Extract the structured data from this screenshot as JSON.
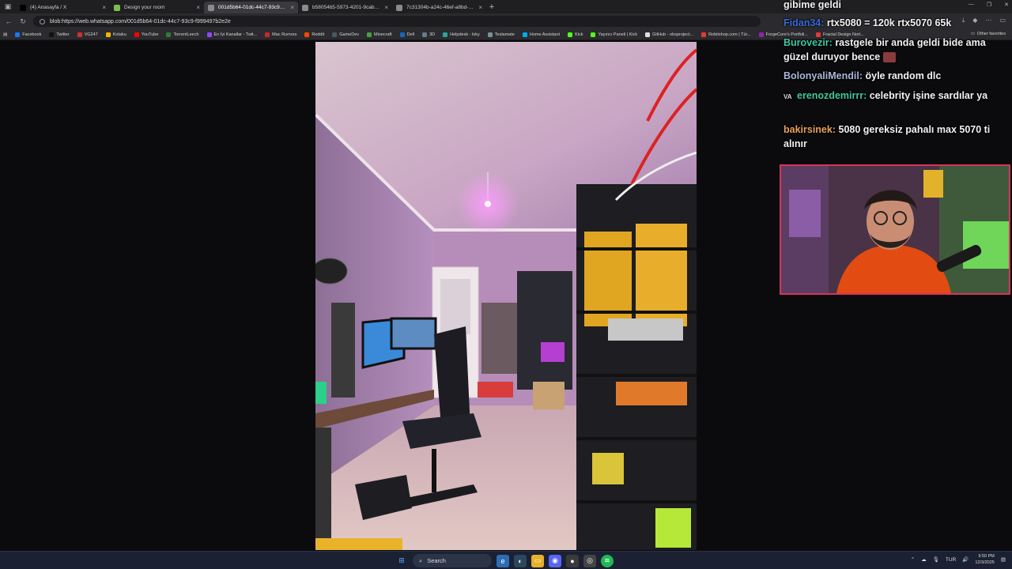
{
  "browser": {
    "tabs": [
      {
        "title": "(4) Anasayfa / X",
        "icon": "x-logo-icon",
        "color": "#000000",
        "active": false
      },
      {
        "title": "Design your room",
        "icon": "design-app-icon",
        "color": "#7bbf4a",
        "active": false
      },
      {
        "title": "001d5b64-01dc-44c7-93c9-f9994...",
        "icon": "globe-icon",
        "color": "#8a8a8a",
        "active": true
      },
      {
        "title": "b58054b5-5973-4201-9cab-0e7...",
        "icon": "globe-icon",
        "color": "#8a8a8a",
        "active": false
      },
      {
        "title": "7c31304b-a24c-46ef-a8bd-134f...",
        "icon": "globe-icon",
        "color": "#8a8a8a",
        "active": false
      }
    ],
    "address": "blob:https://web.whatsapp.com/001d5b64-01dc-44c7-93c9-f999497b2e2e",
    "bookmarks": [
      {
        "label": "Facebook",
        "color": "#1877f2"
      },
      {
        "label": "Twitter",
        "color": "#111111"
      },
      {
        "label": "VG247",
        "color": "#d32f2f"
      },
      {
        "label": "Kotaku",
        "color": "#f4b400"
      },
      {
        "label": "YouTube",
        "color": "#ff0000"
      },
      {
        "label": "TorrentLeech",
        "color": "#2e7d32"
      },
      {
        "label": "En İyi Kanallar - Twit...",
        "color": "#9146ff"
      },
      {
        "label": "Mac Rumors",
        "color": "#c62828"
      },
      {
        "label": "Reddit",
        "color": "#ff4500"
      },
      {
        "label": "GameDev",
        "color": "#455a64"
      },
      {
        "label": "Minecraft",
        "color": "#43a047"
      },
      {
        "label": "Dell",
        "color": "#1565c0"
      },
      {
        "label": "3D",
        "color": "#607d8b"
      },
      {
        "label": "Helpdesk - loky",
        "color": "#26a69a"
      },
      {
        "label": "Teslamate",
        "color": "#78909c"
      },
      {
        "label": "Home Assistant",
        "color": "#03a9f4"
      },
      {
        "label": "Kick",
        "color": "#53fc18"
      },
      {
        "label": "Yayıncı Paneli | Kick",
        "color": "#53fc18"
      },
      {
        "label": "GitHub - obsproject...",
        "color": "#e0e0e0"
      },
      {
        "label": "Robitshop.com | Tür...",
        "color": "#e53935"
      },
      {
        "label": "ForgeCore's Portfoli...",
        "color": "#8e24aa"
      },
      {
        "label": "Fractal Design Nort...",
        "color": "#e53935"
      }
    ],
    "other_bookmarks": "Other favorites"
  },
  "chat": {
    "messages": [
      {
        "user": "",
        "user_color": "#ffffff",
        "text": "gibime geldi"
      },
      {
        "user": "Fidan34:",
        "user_color": "#3a6bd8",
        "text": "rtx5080 = 120k rtx5070 65k"
      },
      {
        "user": "Burovezir:",
        "user_color": "#3ec9a0",
        "text": "rastgele bir anda geldi bide ama güzel duruyor bence"
      },
      {
        "user": "BolonyaliMendil:",
        "user_color": "#a9b7d9",
        "text": "öyle random dlc"
      },
      {
        "user": "erenozdemirrr:",
        "user_color": "#3ec9a0",
        "text": "celebrity işine sardılar ya",
        "badge": "VA"
      },
      {
        "user": "bakirsinek:",
        "user_color": "#e8a15a",
        "text": "5080 gereksiz pahalı max 5070 ti alınır"
      }
    ]
  },
  "taskbar": {
    "search_label": "Search",
    "language": "TUR",
    "time": "9:50 PM",
    "date": "12/3/2025"
  }
}
